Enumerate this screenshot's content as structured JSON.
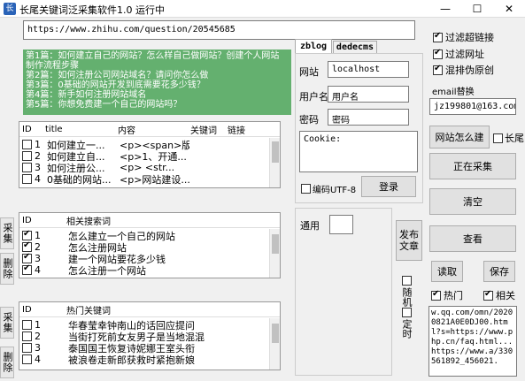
{
  "window": {
    "title": "长尾关键词泛采集软件1.0 运行中",
    "minimize": "—",
    "maximize": "☐",
    "close": "✕"
  },
  "url_input": "https://www.zhihu.com/question/20545685",
  "notes": [
    "第1篇：如何建立自己的网站？怎么样自己做网站？创建个人网站",
    "制作流程步骤",
    "第2篇：如何注册公司网站域名？请问你怎么做",
    "第3篇：0基础的网站开发到底需要花多少钱？",
    "第4篇：新手如何注册网站域名",
    "第5篇：你想免费建一个自己的网站吗？"
  ],
  "content_table": {
    "headers": [
      "ID",
      "title",
      "内容",
      "关键词",
      "链接"
    ],
    "rows": [
      {
        "id": "1",
        "title": "如何建立一...",
        "content": "<p><span>版..."
      },
      {
        "id": "2",
        "title": "如何建立自...",
        "content": "<p>1、开通..."
      },
      {
        "id": "3",
        "title": "如何注册公...",
        "content": "<p>    <str..."
      },
      {
        "id": "4",
        "title": "0基础的网站...",
        "content": "<p>网站建设..."
      }
    ]
  },
  "related_table": {
    "headers": [
      "ID",
      "相关搜索词"
    ],
    "rows": [
      {
        "id": "1",
        "text": "怎么建立一个自己的网站",
        "checked": true
      },
      {
        "id": "2",
        "text": "怎么注册网站",
        "checked": true
      },
      {
        "id": "3",
        "text": "建一个网站要花多少钱",
        "checked": true
      },
      {
        "id": "4",
        "text": "怎么注册一个网站",
        "checked": true
      }
    ]
  },
  "hot_table": {
    "headers": [
      "ID",
      "热门关键词"
    ],
    "rows": [
      {
        "id": "1",
        "text": "华春莹幸钟南山的话回应提问"
      },
      {
        "id": "2",
        "text": "当街打死前女友男子是当地混混"
      },
      {
        "id": "3",
        "text": "泰国国王恢复诗妮娜王室头衔"
      },
      {
        "id": "4",
        "text": "被浪卷走新郎获救时紧抱新娘"
      }
    ]
  },
  "side_tabs": {
    "collect1": "采集",
    "delete1": "删除",
    "collect2": "采集",
    "delete2": "删除"
  },
  "tabs": [
    "zblog",
    "dedecms"
  ],
  "login": {
    "site_label": "网站",
    "site_value": "localhost",
    "user_label": "用户名",
    "user_value": "用户名",
    "pass_label": "密码",
    "pass_value": "密码",
    "cookie_placeholder": "Cookie:",
    "utf8_label": "编码UTF-8",
    "login_button": "登录"
  },
  "general": {
    "label": "通用"
  },
  "publish_button": "发布文章",
  "random_label": "随机",
  "timed_label": "定时",
  "options": {
    "filter_super_link": "过滤超链接",
    "filter_url": "过滤网址",
    "shuffle_original": "混排伪原创"
  },
  "email": {
    "label": "email替换",
    "value": "jz199801@163.com"
  },
  "site_how_button": "网站怎么建",
  "long_tail_label": "长尾",
  "collecting_button": "正在采集",
  "clear_button": "清空",
  "view_button": "查看",
  "read_button": "读取",
  "save_button": "保存",
  "hot_label": "热门",
  "related_label": "相关",
  "log_text": "w.qq.com/omn/20200821A0E0DJ00.html?s=https://www.php.cn/faq.html...https://www.a/330561892_456021."
}
